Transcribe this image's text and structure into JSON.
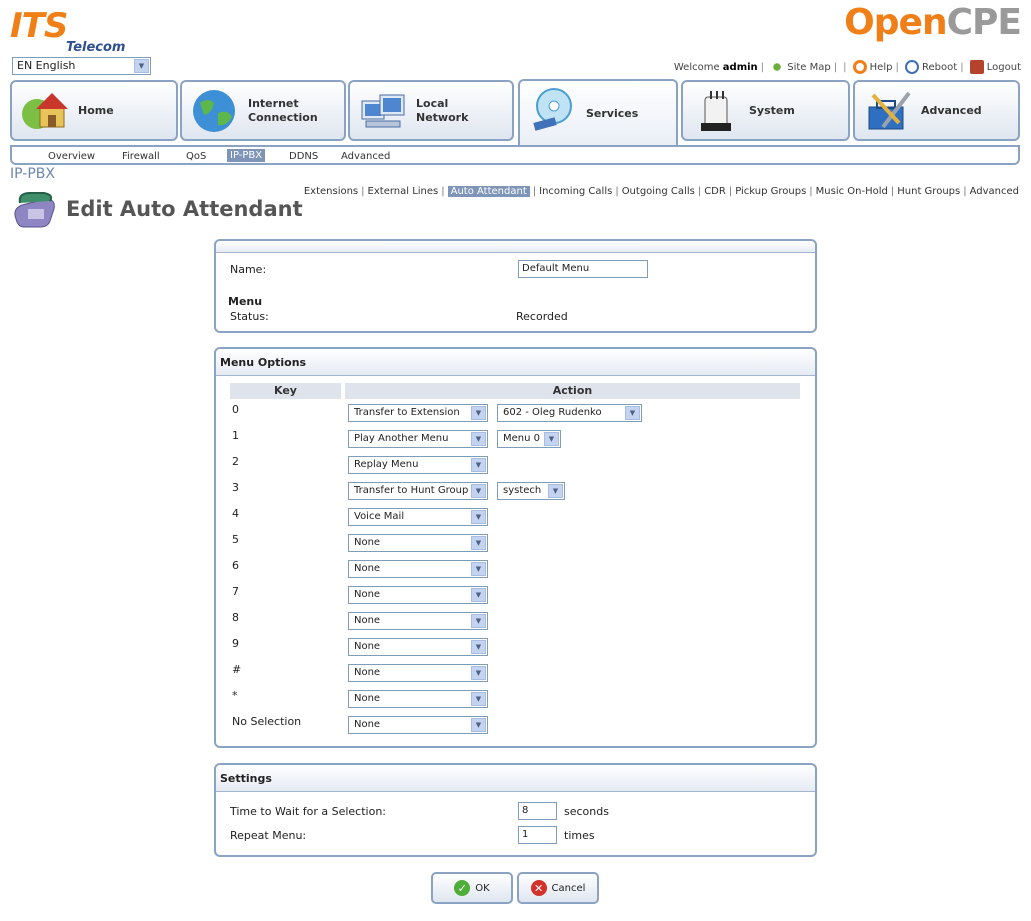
{
  "brand": {
    "left_logo_main": "ITS",
    "left_logo_sub": "Telecom",
    "right_logo_a": "Open",
    "right_logo_b": "CPE"
  },
  "language": {
    "selected": "EN English"
  },
  "userbar": {
    "welcome": "Welcome",
    "user": "admin",
    "site_map": "Site Map",
    "help": "Help",
    "reboot": "Reboot",
    "logout": "Logout"
  },
  "main_tabs": [
    {
      "label": "Home",
      "icon": "home-icon"
    },
    {
      "label": "Internet Connection",
      "icon": "globe-icon"
    },
    {
      "label": "Local Network",
      "icon": "computers-icon"
    },
    {
      "label": "Services",
      "icon": "services-disc-icon",
      "active": true
    },
    {
      "label": "System",
      "icon": "system-device-icon"
    },
    {
      "label": "Advanced",
      "icon": "toolbox-icon"
    }
  ],
  "sub_tabs": [
    "Overview",
    "Firewall",
    "QoS",
    "IP-PBX",
    "DDNS",
    "Advanced"
  ],
  "active_sub_tab": "IP-PBX",
  "page_category": "IP-PBX",
  "tertiary_tabs": [
    "Extensions",
    "External Lines",
    "Auto Attendant",
    "Incoming Calls",
    "Outgoing Calls",
    "CDR",
    "Pickup Groups",
    "Music On-Hold",
    "Hunt Groups",
    "Advanced"
  ],
  "active_tertiary_tab": "Auto Attendant",
  "page_title": "Edit Auto Attendant",
  "general": {
    "name_label": "Name:",
    "name_value": "Default Menu",
    "status_label_1": "Menu",
    "status_label_2": "Status:",
    "status_value": "Recorded"
  },
  "menu_options": {
    "title": "Menu Options",
    "col_key": "Key",
    "col_action": "Action",
    "rows": [
      {
        "key": "0",
        "action": "Transfer to Extension",
        "target": "602 - Oleg Rudenko"
      },
      {
        "key": "1",
        "action": "Play Another Menu",
        "target": "Menu 0"
      },
      {
        "key": "2",
        "action": "Replay Menu"
      },
      {
        "key": "3",
        "action": "Transfer to Hunt Group",
        "target": "systech"
      },
      {
        "key": "4",
        "action": "Voice Mail"
      },
      {
        "key": "5",
        "action": "None"
      },
      {
        "key": "6",
        "action": "None"
      },
      {
        "key": "7",
        "action": "None"
      },
      {
        "key": "8",
        "action": "None"
      },
      {
        "key": "9",
        "action": "None"
      },
      {
        "key": "#",
        "action": "None"
      },
      {
        "key": "*",
        "action": "None"
      },
      {
        "key": "No Selection",
        "action": "None"
      }
    ]
  },
  "settings": {
    "title": "Settings",
    "wait_label": "Time to Wait for a Selection:",
    "wait_value": "8",
    "wait_unit": "seconds",
    "repeat_label": "Repeat Menu:",
    "repeat_value": "1",
    "repeat_unit": "times"
  },
  "buttons": {
    "ok": "OK",
    "cancel": "Cancel"
  },
  "colors": {
    "accent_orange": "#f07f17",
    "frame_blue": "#8aa3c2",
    "active_tab": "#7f95b8"
  }
}
